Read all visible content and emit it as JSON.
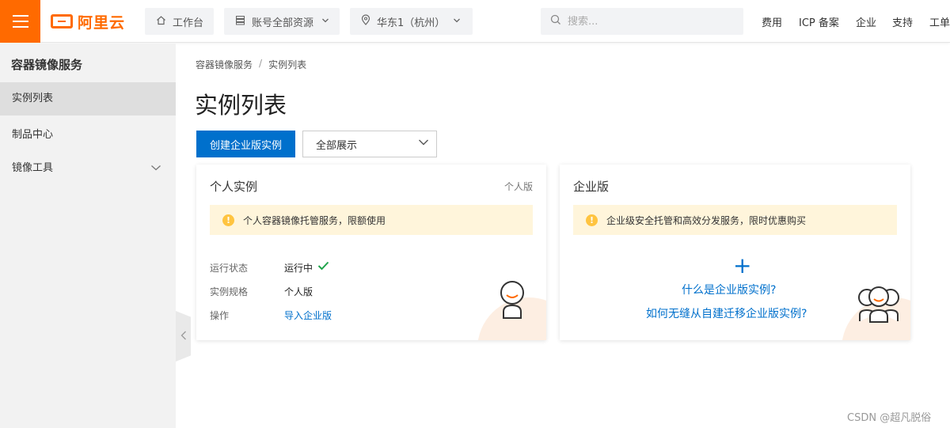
{
  "header": {
    "logo_text": "阿里云",
    "workbench": "工作台",
    "resources": "账号全部资源",
    "region": "华东1（杭州）",
    "search_placeholder": "搜索...",
    "links": [
      "费用",
      "ICP 备案",
      "企业",
      "支持",
      "工单"
    ],
    "brand_color": "#ff6a00"
  },
  "sidebar": {
    "title": "容器镜像服务",
    "items": [
      {
        "label": "实例列表",
        "active": true
      },
      {
        "label": "制品中心",
        "active": false
      },
      {
        "label": "镜像工具",
        "active": false,
        "expandable": true
      }
    ]
  },
  "breadcrumb": [
    "容器镜像服务",
    "/",
    "实例列表"
  ],
  "page": {
    "title": "实例列表",
    "create_button": "创建企业版实例",
    "filter_select": "全部展示",
    "accent_color": "#0070cc"
  },
  "personal_card": {
    "title": "个人实例",
    "tag": "个人版",
    "notice": "个人容器镜像托管服务，限额使用",
    "rows": [
      {
        "key": "运行状态",
        "value": "运行中"
      },
      {
        "key": "实例规格",
        "value": "个人版"
      },
      {
        "key": "操作",
        "value": "导入企业版"
      }
    ]
  },
  "enterprise_card": {
    "title": "企业版",
    "notice": "企业级安全托管和高效分发服务，限时优惠购买",
    "plus": "+",
    "link1": "什么是企业版实例?",
    "link2": "如何无缝从自建迁移企业版实例?"
  },
  "watermark": "CSDN @超凡脱俗"
}
